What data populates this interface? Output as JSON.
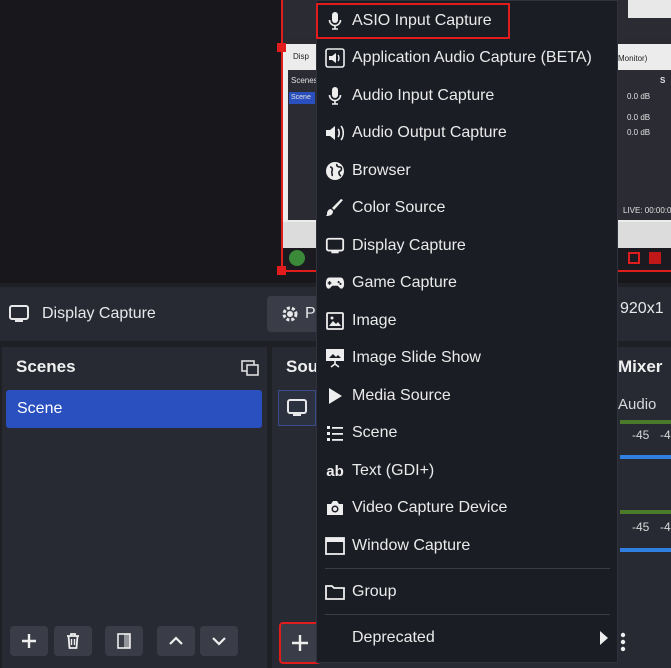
{
  "preview": {
    "mini_scenes_label": "Scenes",
    "mini_scene_item": "Scene",
    "mini_tab_label": "Disp",
    "mini_monitor_label": "Monitor)",
    "mini_db_1": "0.0 dB",
    "mini_db_2": "0.0 dB",
    "mini_db_3": "0.0 dB",
    "mini_live_label": "LIVE: 00:00:0",
    "mini_s_label": "S"
  },
  "source_toolbar": {
    "source_name": "Display Capture",
    "properties_label": "P",
    "resolution_text": "920x1"
  },
  "scenes_dock": {
    "title": "Scenes",
    "items": [
      "Scene"
    ]
  },
  "sources_dock": {
    "title": "Sou"
  },
  "mixer_dock": {
    "title": "Mixer",
    "channel_label": "Audio",
    "db_a": "-45",
    "db_b": "-4",
    "db_c": "-45",
    "db_d": "-4"
  },
  "menu": {
    "items": [
      {
        "label": "ASIO Input Capture",
        "icon": "microphone-icon"
      },
      {
        "label": "Application Audio Capture (BETA)",
        "icon": "speaker-app-icon"
      },
      {
        "label": "Audio Input Capture",
        "icon": "microphone-icon"
      },
      {
        "label": "Audio Output Capture",
        "icon": "speaker-icon"
      },
      {
        "label": "Browser",
        "icon": "globe-icon"
      },
      {
        "label": "Color Source",
        "icon": "paint-brush-icon"
      },
      {
        "label": "Display Capture",
        "icon": "monitor-icon"
      },
      {
        "label": "Game Capture",
        "icon": "gamepad-icon"
      },
      {
        "label": "Image",
        "icon": "image-icon"
      },
      {
        "label": "Image Slide Show",
        "icon": "slideshow-icon"
      },
      {
        "label": "Media Source",
        "icon": "play-icon"
      },
      {
        "label": "Scene",
        "icon": "list-icon"
      },
      {
        "label": "Text (GDI+)",
        "icon": "text-icon"
      },
      {
        "label": "Video Capture Device",
        "icon": "camera-icon"
      },
      {
        "label": "Window Capture",
        "icon": "window-icon"
      },
      {
        "label": "Group",
        "icon": "folder-icon"
      },
      {
        "label": "Deprecated",
        "icon": "submenu-arrow-icon"
      }
    ]
  },
  "colors": {
    "accent_blue": "#2a4fbf",
    "highlight_red": "#e01c1c",
    "menu_bg": "#1b1d24",
    "dock_bg": "#272a33"
  }
}
